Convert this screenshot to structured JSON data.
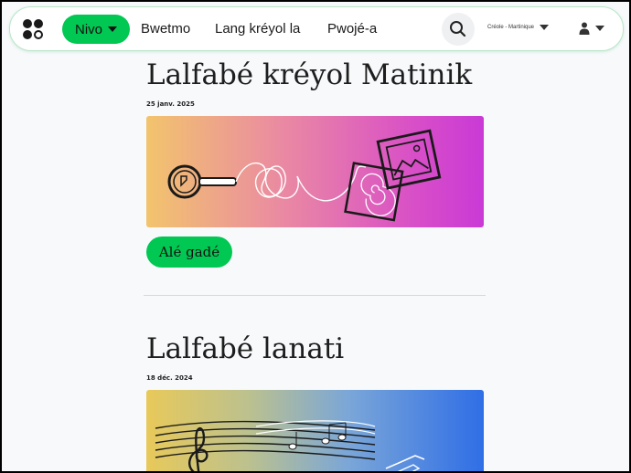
{
  "navbar": {
    "menu_label": "Nivo",
    "links": [
      "Bwetmo",
      "Lang kréyol la",
      "Pwojé-a"
    ],
    "language": "Créole - Martinique",
    "accent": "#00c853"
  },
  "posts": [
    {
      "title": "Lalfabé kréyol Matinik",
      "date": "25 janv. 2025",
      "cta": "Alé gadé"
    },
    {
      "title": "Lalfabé lanati",
      "date": "18 déc. 2024"
    }
  ],
  "icons": {
    "logo": "app-logo-icon",
    "search": "search-icon",
    "user": "user-icon",
    "caret": "chevron-down-icon"
  }
}
